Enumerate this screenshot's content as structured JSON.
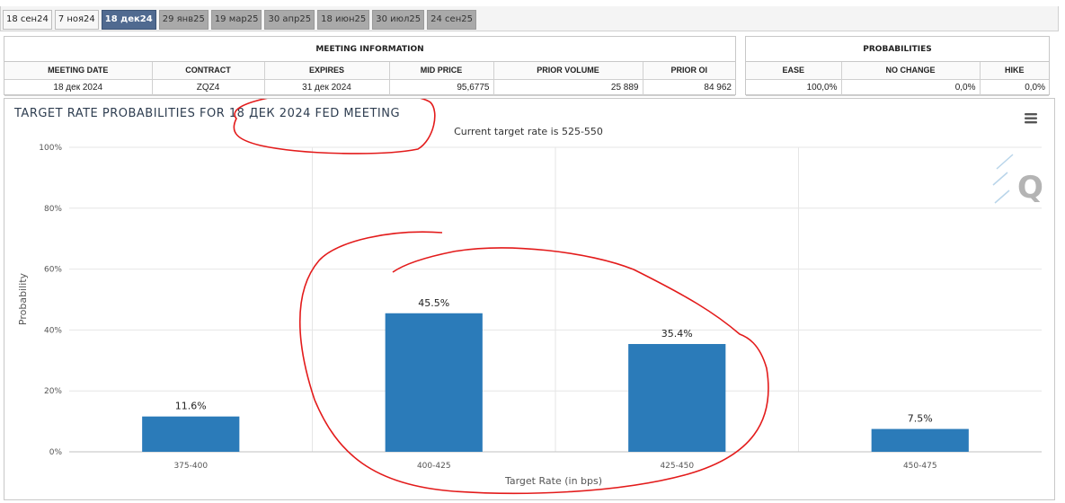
{
  "tabs": [
    {
      "label": "18 сен24",
      "state": "first"
    },
    {
      "label": "7 ноя24",
      "state": "first"
    },
    {
      "label": "18 дек24",
      "state": "active"
    },
    {
      "label": "29 янв25",
      "state": "normal"
    },
    {
      "label": "19 мар25",
      "state": "normal"
    },
    {
      "label": "30 апр25",
      "state": "normal"
    },
    {
      "label": "18 июн25",
      "state": "normal"
    },
    {
      "label": "30 июл25",
      "state": "normal"
    },
    {
      "label": "24 сен25",
      "state": "normal"
    }
  ],
  "meeting_info": {
    "title": "MEETING INFORMATION",
    "headers": [
      "MEETING DATE",
      "CONTRACT",
      "EXPIRES",
      "MID PRICE",
      "PRIOR VOLUME",
      "PRIOR OI"
    ],
    "row": [
      "18 дек 2024",
      "ZQZ4",
      "31 дек 2024",
      "95,6775",
      "25 889",
      "84 962"
    ]
  },
  "probabilities": {
    "title": "PROBABILITIES",
    "headers": [
      "EASE",
      "NO CHANGE",
      "HIKE"
    ],
    "row": [
      "100,0%",
      "0,0%",
      "0,0%"
    ]
  },
  "chart_data": {
    "type": "bar",
    "title": "TARGET RATE PROBABILITIES FOR 18 ДЕК 2024 FED MEETING",
    "subtitle": "Current target rate is 525-550",
    "xlabel": "Target Rate (in bps)",
    "ylabel": "Probability",
    "categories": [
      "375-400",
      "400-425",
      "425-450",
      "450-475"
    ],
    "values": [
      11.6,
      45.5,
      35.4,
      7.5
    ],
    "data_labels": [
      "11.6%",
      "45.5%",
      "35.4%",
      "7.5%"
    ],
    "y_ticks": [
      "0%",
      "20%",
      "40%",
      "60%",
      "80%",
      "100%"
    ],
    "ylim": [
      0,
      100
    ],
    "grid": true,
    "bar_color": "#2b7bb9"
  },
  "colors": {
    "annotation": "#e31b1b",
    "active_tab": "#506a90"
  },
  "icons": {
    "menu": "hamburger-menu-icon",
    "logo": "quikstrike-q-logo"
  }
}
